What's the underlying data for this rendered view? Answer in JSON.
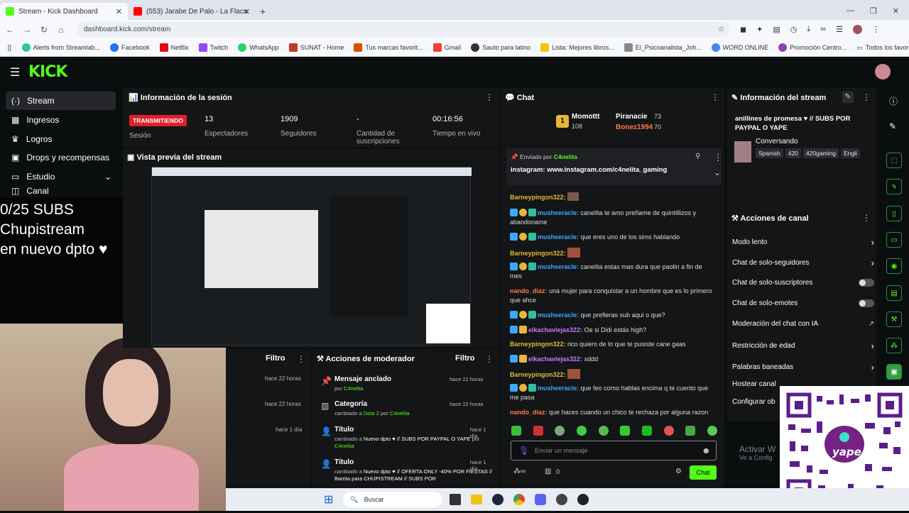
{
  "browser": {
    "tabs": [
      {
        "label": "Stream - Kick Dashboard",
        "active": true
      },
      {
        "label": "(553) Jarabe De Palo - La Flaca",
        "active": false
      }
    ],
    "url": "dashboard.kick.com/stream",
    "bookmarks": [
      "Alerts from Streamlab...",
      "Facebook",
      "Netflix",
      "Twitch",
      "WhatsApp",
      "SUNAT - Home",
      "Tus marcas favorit...",
      "Gmail",
      "Sauto para latino",
      "Lista: Mejores libros...",
      "El_Psicoanalista_Joh...",
      "WORD ONLINE",
      "Promoción Centro..."
    ],
    "all_bookmarks": "Todos los favoritos"
  },
  "brand": "KICK",
  "sidebar": {
    "items": [
      "Stream",
      "Ingresos",
      "Logros",
      "Drops y recompensas",
      "Estudio",
      "Canal"
    ]
  },
  "overlay": {
    "line1": "0/25 SUBS",
    "line2": "Chupistream",
    "line3": "en nuevo dpto ♥"
  },
  "session": {
    "title": "Información de la sesión",
    "live_badge": "TRANSMITIENDO",
    "session_label": "Sesión",
    "stats": [
      {
        "value": "13",
        "label": "Espectadores"
      },
      {
        "value": "1909",
        "label": "Seguidores"
      },
      {
        "value": "-",
        "label": "Cantidad de suscripciones"
      },
      {
        "value": "00:16:56",
        "label": "Tiempo en vivo"
      }
    ]
  },
  "preview": {
    "title": "Vista previa del stream"
  },
  "filter_panel": {
    "title": "Filtro",
    "times": [
      "hace 22 horas",
      "hace 22 horas",
      "hace 1 día"
    ]
  },
  "mod_actions": {
    "title": "Acciones de moderador",
    "filter": "Filtro",
    "items": [
      {
        "title": "Mensaje anclado",
        "sub": "por ",
        "who": "C4nelita",
        "time": "hace 22 horas"
      },
      {
        "title": "Categoría",
        "sub": "cambiado a ",
        "who": "Dota 2",
        "sub2": " por ",
        "who2": "C4nelita",
        "time": "hace 22 horas"
      },
      {
        "title": "Título",
        "sub": "cambiado a ",
        "who": "Nuevo dpto ♥ // SUBS POR PAYPAL O YAPE",
        "sub2": " por ",
        "who2": "C4nelita",
        "time": "hace 1 día"
      },
      {
        "title": "Título",
        "sub": "cambiado a ",
        "who": "Nuevo dpto ♥ // OFERTA ONLY -40% POR FIESTAS // Barrita para CHUPISTREAM // SUBS POR",
        "time": "hace 1 día"
      }
    ]
  },
  "chat": {
    "title": "Chat",
    "leaders": [
      {
        "name": "Momottt",
        "count": "108"
      },
      {
        "name": "Piranacie",
        "count": "73"
      },
      {
        "name": "Bonez1994",
        "count": "70"
      }
    ],
    "pinned_by": "Enviado por",
    "pinned_user": "C4nelita",
    "pinned_text": "instagram: www.instagram.com/c4nelita_gaming",
    "messages": [
      {
        "user": "Barneypingon322:",
        "text": "",
        "cls": "u-yellow"
      },
      {
        "user": "musheeracle:",
        "text": " canelita te amo preñame de quintillizos y abandoname",
        "cls": "u-blue"
      },
      {
        "user": "musheeracle:",
        "text": " que eres uno de los sims hablando",
        "cls": "u-blue"
      },
      {
        "user": "Barneypingon322:",
        "text": "",
        "cls": "u-yellow"
      },
      {
        "user": "musheeracle:",
        "text": " canelita estas mas dura que paolin a fin de mes",
        "cls": "u-blue"
      },
      {
        "user": "nando_diaz:",
        "text": " una mujer para conquistar a un hombre que es lo primero que ahce",
        "cls": "u-orange"
      },
      {
        "user": "musheeracle:",
        "text": " que prefieras sub aqui o que?",
        "cls": "u-blue"
      },
      {
        "user": "elkachaviejas322:",
        "text": " Oe si Didi estás high?",
        "cls": "u-blue"
      },
      {
        "user": "Barneypingon322:",
        "text": " rico quiero de lo que te pusiste cane gaas",
        "cls": "u-yellow"
      },
      {
        "user": "elkachaviejas322:",
        "text": " xddd",
        "cls": "u-blue"
      },
      {
        "user": "Barneypingon322:",
        "text": "",
        "cls": "u-yellow"
      },
      {
        "user": "musheeracle:",
        "text": " que feo como hablas encima q te cuento que me pasa",
        "cls": "u-blue"
      },
      {
        "user": "nando_diaz:",
        "text": " que haces cuando un chico te rechaza por alguna razon",
        "cls": "u-orange"
      }
    ],
    "input_placeholder": "Enviar un mensaje",
    "points": "0",
    "send_label": "Chat"
  },
  "stream_info": {
    "title": "Información del stream",
    "stream_title": "anillines de promesa ♥ // SUBS POR PAYPAL O YAPE",
    "category": "Conversando",
    "tags": [
      "Spanish",
      "420",
      "420gaming",
      "Engli"
    ]
  },
  "channel_actions": {
    "title": "Acciones de canal",
    "items": [
      "Modo lento",
      "Chat de solo-seguidores",
      "Chat de solo-suscriptores",
      "Chat de solo-emotes",
      "Moderación del chat con IA",
      "Restricción de edad",
      "Palabras baneadas",
      "Hostear canal",
      "Configurar ob"
    ]
  },
  "watermark": {
    "line1": "Activar W",
    "line2": "Ve a Config"
  },
  "taskbar": {
    "search": "Buscar"
  },
  "qr_label": "yape"
}
